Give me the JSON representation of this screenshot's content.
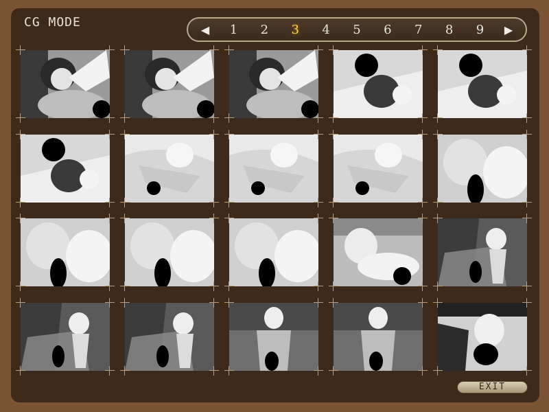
{
  "header": {
    "title": "CG MODE"
  },
  "pager": {
    "prev_icon": "left-triangle-icon",
    "next_icon": "right-triangle-icon",
    "pages": [
      "1",
      "2",
      "3",
      "4",
      "5",
      "6",
      "7",
      "8",
      "9"
    ],
    "active_page": "3"
  },
  "thumbnails": {
    "rows": 4,
    "cols": 5,
    "variants": [
      [
        "a",
        "a",
        "a",
        "b",
        "b"
      ],
      [
        "b",
        "c",
        "c",
        "c",
        "d"
      ],
      [
        "d",
        "d",
        "d",
        "e",
        "f"
      ],
      [
        "f",
        "f",
        "g",
        "g",
        "h"
      ]
    ]
  },
  "footer": {
    "exit_label": "EXIT"
  },
  "colors": {
    "background": "#7a5535",
    "frame": "#3e2a1a",
    "active_page": "#ffd34a"
  }
}
